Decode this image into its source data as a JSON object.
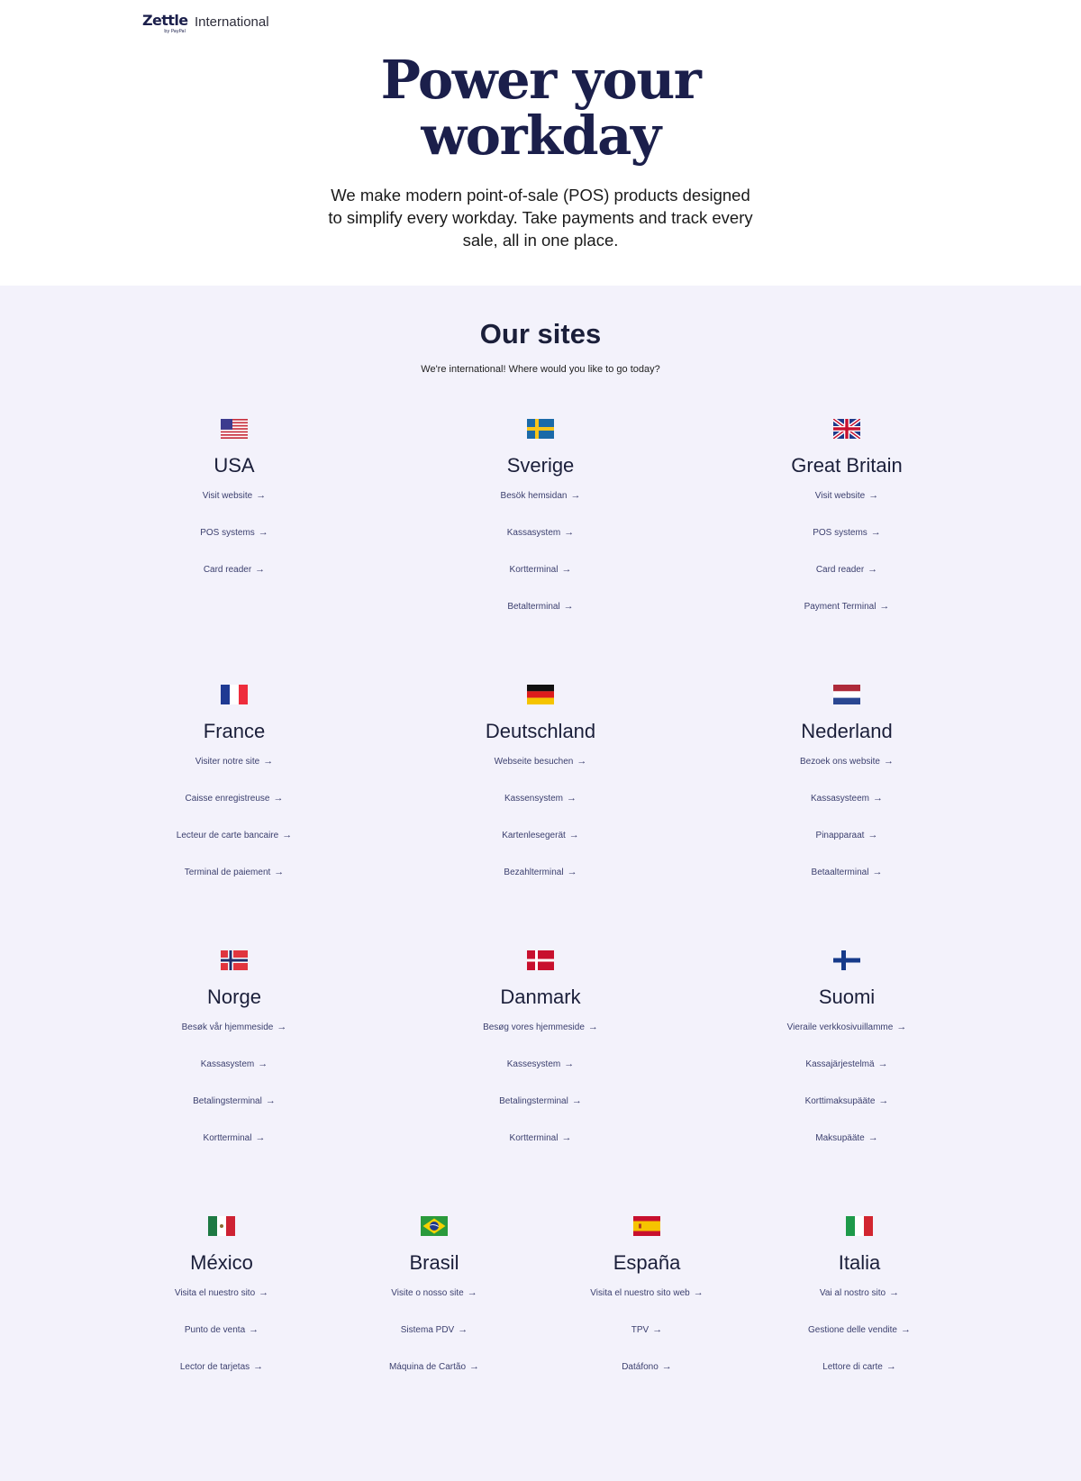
{
  "header": {
    "logo_text": "Zettle",
    "logo_sub": "by PayPal",
    "site_name": "International"
  },
  "hero": {
    "title_line1": "Power your",
    "title_line2": "workday",
    "subtitle_line1": "We make modern point-of-sale (POS) products designed",
    "subtitle_line2": "to simplify every workday. Take payments and track every",
    "subtitle_line3": "sale, all in one place."
  },
  "sites": {
    "title": "Our sites",
    "subtitle": "We're international! Where would you like to go today?",
    "arrow": "→",
    "countries": [
      {
        "name": "USA",
        "flag": "us-flag-icon",
        "links": [
          "Visit website",
          "POS systems",
          "Card reader"
        ]
      },
      {
        "name": "Sverige",
        "flag": "sweden-flag-icon",
        "links": [
          "Besök hemsidan",
          "Kassasystem",
          "Kortterminal",
          "Betalterminal"
        ]
      },
      {
        "name": "Great Britain",
        "flag": "uk-flag-icon",
        "links": [
          "Visit website",
          "POS systems",
          "Card reader",
          "Payment Terminal"
        ]
      },
      {
        "name": "France",
        "flag": "france-flag-icon",
        "links": [
          "Visiter notre site",
          "Caisse enregistreuse",
          "Lecteur de carte bancaire",
          "Terminal de paiement"
        ]
      },
      {
        "name": "Deutschland",
        "flag": "germany-flag-icon",
        "links": [
          "Webseite besuchen",
          "Kassensystem",
          "Kartenlesegerät",
          "Bezahlterminal"
        ]
      },
      {
        "name": "Nederland",
        "flag": "netherlands-flag-icon",
        "links": [
          "Bezoek ons website",
          "Kassasysteem",
          "Pinapparaat",
          "Betaalterminal"
        ]
      },
      {
        "name": "Norge",
        "flag": "norway-flag-icon",
        "links": [
          "Besøk vår hjemmeside",
          "Kassasystem",
          "Betalingsterminal",
          "Kortterminal"
        ]
      },
      {
        "name": "Danmark",
        "flag": "denmark-flag-icon",
        "links": [
          "Besøg vores hjemmeside",
          "Kassesystem",
          "Betalingsterminal",
          "Kortterminal"
        ]
      },
      {
        "name": "Suomi",
        "flag": "finland-flag-icon",
        "links": [
          "Vieraile verkkosivuillamme",
          "Kassajärjestelmä",
          "Korttimaksupääte",
          "Maksupääte"
        ]
      },
      {
        "name": "México",
        "flag": "mexico-flag-icon",
        "links": [
          "Visita el nuestro sito",
          "Punto de venta",
          "Lector de tarjetas"
        ]
      },
      {
        "name": "Brasil",
        "flag": "brazil-flag-icon",
        "links": [
          "Visite o nosso site",
          "Sistema PDV",
          "Máquina de Cartão"
        ]
      },
      {
        "name": "España",
        "flag": "spain-flag-icon",
        "links": [
          "Visita el nuestro sito web",
          "TPV",
          "Datáfono"
        ]
      },
      {
        "name": "Italia",
        "flag": "italy-flag-icon",
        "links": [
          "Vai al nostro sito",
          "Gestione delle vendite",
          "Lettore di carte"
        ]
      }
    ]
  }
}
